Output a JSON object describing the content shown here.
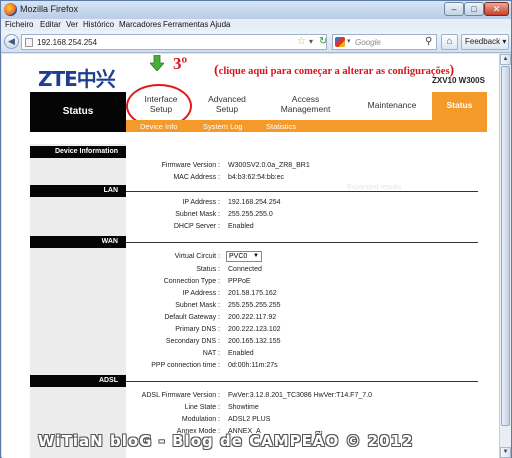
{
  "window": {
    "title": "Mozilla Firefox",
    "minimize_symbol": "–",
    "maximize_symbol": "□",
    "close_symbol": "✕"
  },
  "menubar": [
    "Ficheiro",
    "Editar",
    "Ver",
    "Histórico",
    "Marcadores",
    "Ferramentas",
    "Ajuda"
  ],
  "navbar": {
    "back_symbol": "◀",
    "url": "192.168.254.254",
    "search_placeholder": "Google",
    "feedback_label": "Feedback ▾",
    "icons": [
      "back-icon",
      "page-icon",
      "bookmark-star-icon",
      "reload-icon",
      "google-icon",
      "magnifier-icon",
      "home-icon"
    ]
  },
  "page": {
    "logo": "ZTE中兴",
    "model": "ZXV10 W300S",
    "callout": {
      "number": "3º",
      "text": "clique aqui para começar a alterar as configurações",
      "color": "#d8151a"
    },
    "tabs": {
      "status_left": "Status",
      "interface_line1": "Interface",
      "interface_line2": "Setup",
      "advanced_line1": "Advanced",
      "advanced_line2": "Setup",
      "access_line1": "Access",
      "access_line2": "Management",
      "maintenance": "Maintenance",
      "status_right": "Status"
    },
    "subnav": [
      "Device Info",
      "System Log",
      "Statistics"
    ],
    "accent_color": "#f39a2b",
    "sections": {
      "device": "Device Information",
      "lan": "LAN",
      "wan": "WAN",
      "adsl": "ADSL"
    },
    "device": {
      "firmware_label": "Firmware Version :",
      "firmware": "W300SV2.0.0a_ZR8_BR1",
      "mac_label": "MAC Address :",
      "mac": "b4:b3:62:54:bb:ec"
    },
    "lan": {
      "ip_label": "IP Address :",
      "ip": "192.168.254.254",
      "mask_label": "Subnet Mask :",
      "mask": "255.255.255.0",
      "dhcp_label": "DHCP Server :",
      "dhcp": "Enabled"
    },
    "wan": {
      "vc_label": "Virtual Circuit :",
      "vc": "PVC0",
      "status_label": "Status :",
      "status": "Connected",
      "conn_label": "Connection Type :",
      "conn": "PPPoE",
      "ip_label": "IP Address :",
      "ip": "201.58.175.162",
      "mask_label": "Subnet Mask :",
      "mask": "255.255.255.255",
      "gw_label": "Default Gateway :",
      "gw": "200.222.117.92",
      "dns1_label": "Primary DNS :",
      "dns1": "200.222.123.102",
      "dns2_label": "Secondary DNS :",
      "dns2": "200.165.132.155",
      "nat_label": "NAT :",
      "nat": "Enabled",
      "ppp_label": "PPP connection time :",
      "ppp": "0d:00h:11m:27s"
    },
    "adsl": {
      "fw_label": "ADSL Firmware Version :",
      "fw": "FwVer:3.12.8.201_TC3086 HwVer:T14.F7_7.0",
      "state_label": "Line State :",
      "state": "Showtime",
      "mod_label": "Modulation :",
      "mod": "ADSL2 PLUS",
      "annex_label": "Annex Mode :",
      "annex": "ANNEX_A"
    },
    "watermark": "WiTiaN bloG - Blog de CAMPEÃO © 2012"
  }
}
